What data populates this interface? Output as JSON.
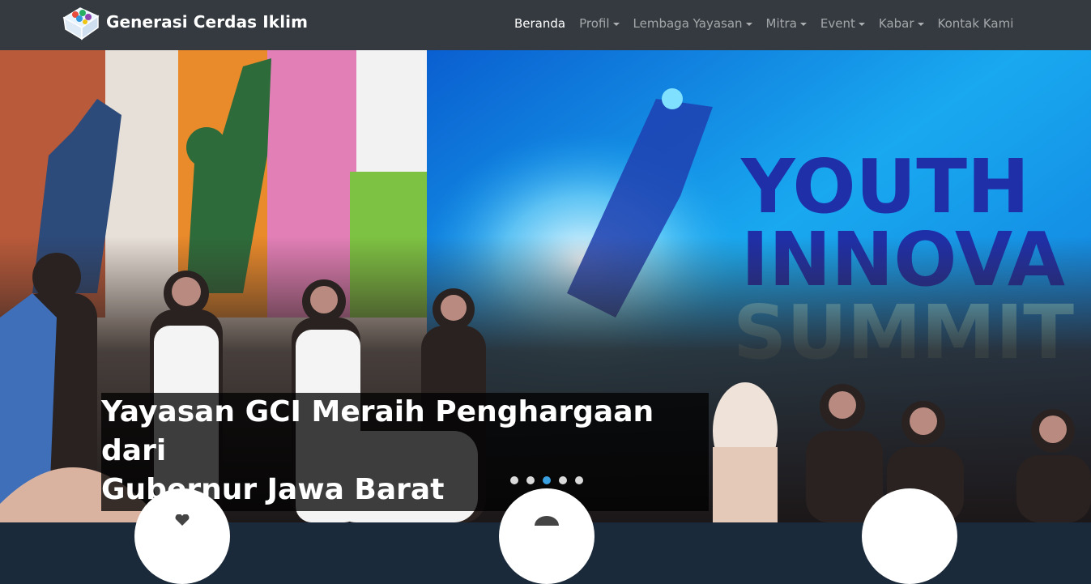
{
  "brand": {
    "name": "Generasi Cerdas Iklim",
    "logo_icon": "gci-logo-icon"
  },
  "nav": {
    "items": [
      {
        "label": "Beranda",
        "active": true,
        "dropdown": false
      },
      {
        "label": "Profil",
        "active": false,
        "dropdown": true
      },
      {
        "label": "Lembaga Yayasan",
        "active": false,
        "dropdown": true
      },
      {
        "label": "Mitra",
        "active": false,
        "dropdown": true
      },
      {
        "label": "Event",
        "active": false,
        "dropdown": true
      },
      {
        "label": "Kabar",
        "active": false,
        "dropdown": true
      },
      {
        "label": "Kontak Kami",
        "active": false,
        "dropdown": false
      }
    ]
  },
  "hero": {
    "backdrop_text": [
      "YOUTH",
      "INNOVA",
      "SUMMIT"
    ],
    "caption_lines": [
      "Yayasan GCI Meraih Penghargaan dari",
      "Gubernur Jawa Barat"
    ],
    "slides_total": 5,
    "active_slide": 3
  },
  "features": [
    {
      "icon": "heart-icon"
    },
    {
      "icon": "person-icon"
    },
    {
      "icon": "circle-icon"
    }
  ],
  "colors": {
    "navbar": "#343a40",
    "indicator_active": "#3aa0e0"
  }
}
